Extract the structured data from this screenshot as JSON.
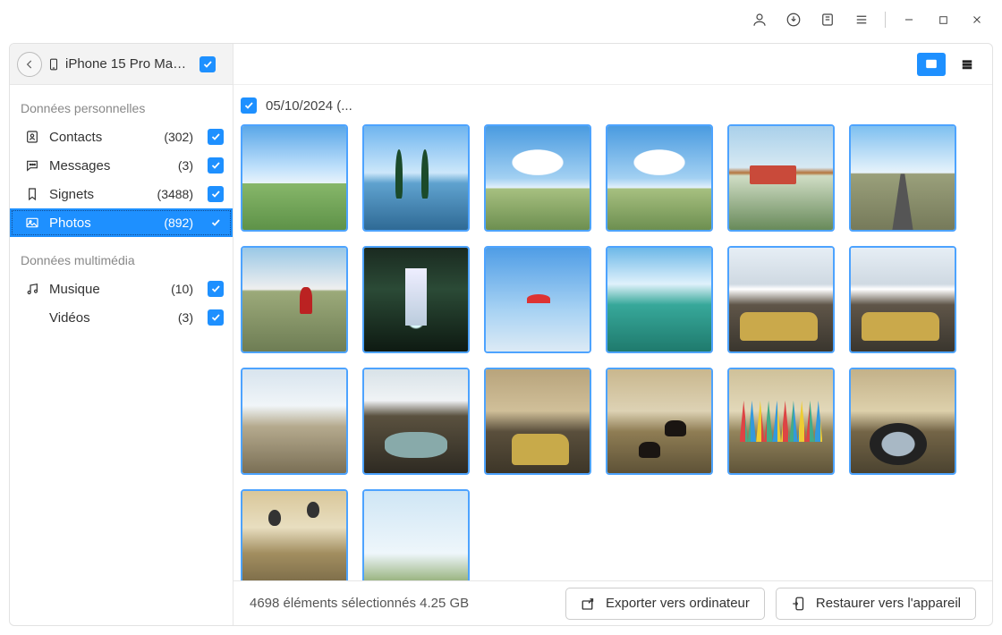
{
  "titlebar": {
    "icons": [
      "user-icon",
      "download-icon",
      "clipboard-icon",
      "menu-icon",
      "minimize-icon",
      "maximize-icon",
      "close-icon"
    ]
  },
  "sidebar": {
    "device_name": "iPhone 15 Pro Max...",
    "section_personal": "Données personnelles",
    "section_multimedia": "Données multimédia",
    "items_personal": [
      {
        "icon": "contacts",
        "label": "Contacts",
        "count": "(302)",
        "checked": true,
        "active": false
      },
      {
        "icon": "messages",
        "label": "Messages",
        "count": "(3)",
        "checked": true,
        "active": false
      },
      {
        "icon": "bookmarks",
        "label": "Signets",
        "count": "(3488)",
        "checked": true,
        "active": false
      },
      {
        "icon": "photos",
        "label": "Photos",
        "count": "(892)",
        "checked": true,
        "active": true
      }
    ],
    "items_multimedia": [
      {
        "icon": "music",
        "label": "Musique",
        "count": "(10)",
        "checked": true,
        "indent": false
      },
      {
        "icon": "",
        "label": "Vidéos",
        "count": "(3)",
        "checked": true,
        "indent": true
      }
    ]
  },
  "group_date": "05/10/2024 (...",
  "thumbnails": [
    "sky",
    "lake-trees",
    "clouds",
    "clouds",
    "harbor",
    "road",
    "runner",
    "waterfall",
    "paraglide",
    "tealLake",
    "snowCar",
    "snowCar",
    "snowPlain",
    "creek",
    "sitCar",
    "yaks",
    "flags",
    "mirror",
    "balloons",
    "skybig"
  ],
  "footer": {
    "status": "4698 éléments sélectionnés 4.25 GB",
    "export": "Exporter vers ordinateur",
    "restore": "Restaurer vers l'appareil"
  }
}
